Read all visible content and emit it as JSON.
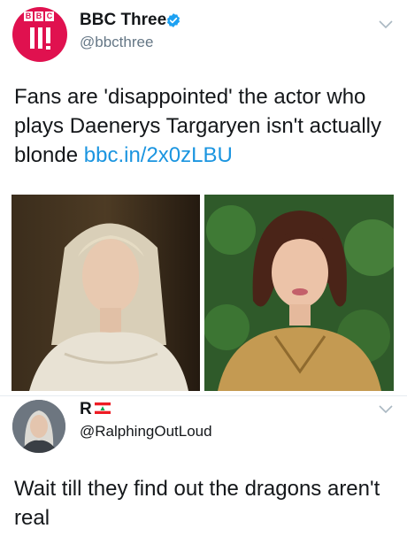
{
  "tweets": [
    {
      "name": "BBC Three",
      "handle": "@bbcthree",
      "logo_letters": [
        "B",
        "B",
        "C"
      ],
      "text": "Fans are 'disappointed' the actor who plays Daenerys Targaryen isn't actually blonde ",
      "link": "bbc.in/2x0zLBU",
      "verified": true,
      "avatar_color": "#e0114f"
    },
    {
      "name": "R",
      "handle": "@RalphingOutLoud",
      "text": "Wait till they find out the dragons aren't real",
      "flag_icon": "lebanon-flag-icon"
    }
  ],
  "colors": {
    "link": "#1b95e0",
    "verified": "#1da1f2",
    "handle_gray": "#657786"
  },
  "icons": [
    "bbc-three-logo-icon",
    "verified-badge-icon",
    "chevron-down-icon",
    "lebanon-flag-icon"
  ]
}
